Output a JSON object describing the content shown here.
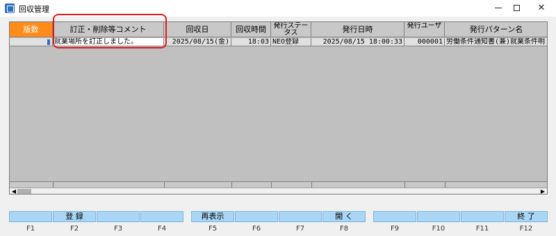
{
  "window": {
    "title": "回収管理",
    "controls": {
      "minimize_icon": "minimize-icon",
      "maximize_icon": "maximize-icon",
      "close": "✕"
    }
  },
  "grid": {
    "columns": [
      "版数",
      "訂正・削除等コメント",
      "回収日",
      "回収時間",
      "発行ステータス",
      "発行日時",
      "発行ユーザ",
      "発行パターン名"
    ],
    "rows": [
      {
        "version": "",
        "comment": "就業場所を訂正しました。",
        "recovery_date": "2025/08/15(金)",
        "recovery_time": "18:03",
        "issue_status": "NEO登録",
        "issue_datetime": "2025/08/15 18:00:33",
        "issue_user": "000001",
        "pattern_name": "労働条件通知書(兼)就業条件明"
      }
    ],
    "scroll": {
      "left": "◀",
      "right": "▶"
    },
    "accent_color": "#ff8c1a",
    "highlight_color": "#e01919"
  },
  "fkeys": [
    {
      "label": "",
      "key": "F1"
    },
    {
      "label": "登 録",
      "key": "F2"
    },
    {
      "label": "",
      "key": "F3"
    },
    {
      "label": "",
      "key": "F4"
    },
    {
      "label": "再表示",
      "key": "F5"
    },
    {
      "label": "",
      "key": "F6"
    },
    {
      "label": "",
      "key": "F7"
    },
    {
      "label": "開 く",
      "key": "F8"
    },
    {
      "label": "",
      "key": "F9"
    },
    {
      "label": "",
      "key": "F10"
    },
    {
      "label": "",
      "key": "F11"
    },
    {
      "label": "終 了",
      "key": "F12"
    }
  ]
}
